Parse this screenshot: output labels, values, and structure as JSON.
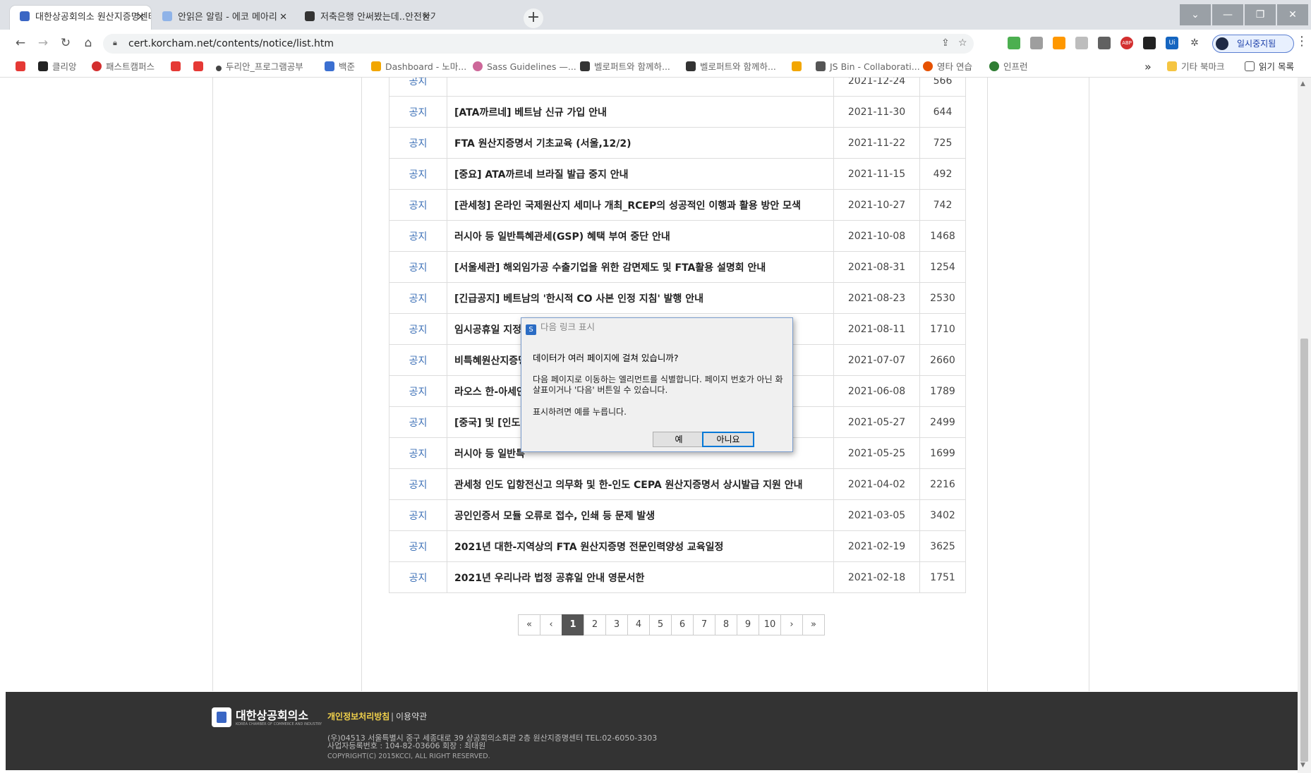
{
  "tabs": [
    {
      "title": "대한상공회의소 원산지증명센터",
      "active": true,
      "favicon_color": "#3a66c4"
    },
    {
      "title": "안읽은 알림 - 에코 메아리",
      "active": false,
      "favicon_color": "#8fb3e8"
    },
    {
      "title": "저축은행 안써봤는데..안전한가요",
      "active": false,
      "favicon_color": "#333333"
    }
  ],
  "window_controls": {
    "menu": "⌄",
    "minimize": "—",
    "restore": "❐",
    "close": "✕"
  },
  "toolbar": {
    "url": "cert.korcham.net/contents/notice/list.htm",
    "profile_label": "일시중지됨"
  },
  "bookmarks": [
    {
      "label": "",
      "color": "#e53935",
      "icon": "youtube-icon"
    },
    {
      "label": "클리앙",
      "color": "#222222",
      "icon": "clien-icon"
    },
    {
      "label": "패스트캠퍼스",
      "color": "#d32f2f",
      "icon": "fastcampus-icon"
    },
    {
      "label": "",
      "color": "#e53935",
      "icon": "youtube-icon"
    },
    {
      "label": "",
      "color": "#e53935",
      "icon": "youtube-icon"
    },
    {
      "label": "두리안_프로그램공부",
      "color": "#444444",
      "icon": "dot-grid-icon"
    },
    {
      "label": "백준",
      "color": "#3b6fd1",
      "icon": "code-icon"
    },
    {
      "label": "Dashboard - 노마...",
      "color": "#f2a600",
      "icon": "warning-icon"
    },
    {
      "label": "Sass Guidelines —...",
      "color": "#cd6799",
      "icon": "sass-icon"
    },
    {
      "label": "벨로퍼트와 함께하...",
      "color": "#333333",
      "icon": "book-icon"
    },
    {
      "label": "벨로퍼트와 함께하...",
      "color": "#333333",
      "icon": "book-icon"
    },
    {
      "label": "",
      "color": "#f2a600",
      "icon": "warning-icon"
    },
    {
      "label": "JS Bin - Collaborati...",
      "color": "#555555",
      "icon": "jsbin-icon"
    },
    {
      "label": "영타 연습",
      "color": "#e65100",
      "icon": "typing-icon"
    },
    {
      "label": "인프런",
      "color": "#2e7d32",
      "icon": "inflearn-icon"
    }
  ],
  "bookmarks_right": {
    "more": "»",
    "other": "기타 북마크",
    "reading_list": "읽기 목록"
  },
  "notices": [
    {
      "category": "공지",
      "title": "",
      "date": "2021-12-24",
      "views": "566"
    },
    {
      "category": "공지",
      "title": "[ATA까르네] 베트남 신규 가입 안내",
      "date": "2021-11-30",
      "views": "644"
    },
    {
      "category": "공지",
      "title": "FTA 원산지증명서 기초교육 (서울,12/2)",
      "date": "2021-11-22",
      "views": "725"
    },
    {
      "category": "공지",
      "title": "[중요] ATA까르네 브라질 발급 중지 안내",
      "date": "2021-11-15",
      "views": "492"
    },
    {
      "category": "공지",
      "title": "[관세청] 온라인 국제원산지 세미나 개최_RCEP의 성공적인 이행과 활용 방안 모색",
      "date": "2021-10-27",
      "views": "742"
    },
    {
      "category": "공지",
      "title": "러시아 등 일반특혜관세(GSP) 혜택 부여 중단 안내",
      "date": "2021-10-08",
      "views": "1468"
    },
    {
      "category": "공지",
      "title": "[서울세관] 해외임가공 수출기업을 위한 감면제도 및 FTA활용 설명회 안내",
      "date": "2021-08-31",
      "views": "1254"
    },
    {
      "category": "공지",
      "title": "[긴급공지] 베트남의 '한시적 CO 사본 인정 지침' 발행 안내",
      "date": "2021-08-23",
      "views": "2530"
    },
    {
      "category": "공지",
      "title": "임시공휴일 지정으",
      "date": "2021-08-11",
      "views": "1710"
    },
    {
      "category": "공지",
      "title": "비특혜원산지증명",
      "date": "2021-07-07",
      "views": "2660"
    },
    {
      "category": "공지",
      "title": "라오스 한-아세안",
      "date": "2021-06-08",
      "views": "1789"
    },
    {
      "category": "공지",
      "title": "[중국] 및 [인도네",
      "date": "2021-05-27",
      "views": "2499"
    },
    {
      "category": "공지",
      "title": "러시아 등 일반특",
      "date": "2021-05-25",
      "views": "1699"
    },
    {
      "category": "공지",
      "title": "관세청 인도 입항전신고 의무화 및 한-인도 CEPA 원산지증명서 상시발급 지원 안내",
      "date": "2021-04-02",
      "views": "2216"
    },
    {
      "category": "공지",
      "title": "공인인증서 모듈 오류로 접수, 인쇄 등 문제 발생",
      "date": "2021-03-05",
      "views": "3402"
    },
    {
      "category": "공지",
      "title": "2021년 대한-지역상의 FTA 원산지증명 전문인력양성 교육일정",
      "date": "2021-02-19",
      "views": "3625"
    },
    {
      "category": "공지",
      "title": "2021년 우리나라 법정 공휴일 안내 영문서한",
      "date": "2021-02-18",
      "views": "1751"
    }
  ],
  "pagination": {
    "first": "«",
    "prev": "‹",
    "pages": [
      "1",
      "2",
      "3",
      "4",
      "5",
      "6",
      "7",
      "8",
      "9",
      "10"
    ],
    "current": "1",
    "next": "›",
    "last": "»"
  },
  "footer": {
    "logo_text": "대한상공회의소",
    "logo_sub": "KOREA CHAMBER OF COMMERCE AND INDUSTRY",
    "privacy_link": "개인정보처리방침",
    "terms_link": "이용약관",
    "address": "(우)04513 서울특별시 중구 세종대로 39 상공회의소회관 2층 원산지증명센터 TEL:02-6050-3303",
    "business_no": "사업자등록번호 : 104-82-03606    회장 : 최태원",
    "copyright": "COPYRIGHT(C) 2015KCCI, ALL RIGHT RESERVED."
  },
  "dialog": {
    "title": "다음 링크 표시",
    "question": "데이터가 여러 페이지에 걸쳐 있습니까?",
    "description": "다음 페이지로 이동하는 엘리먼트를 식별합니다. 페이지 번호가 아닌 화살표이거나 '다음' 버튼일 수 있습니다.",
    "instruction": "표시하려면 예를 누릅니다.",
    "yes_label": "예",
    "no_label": "아니요"
  }
}
